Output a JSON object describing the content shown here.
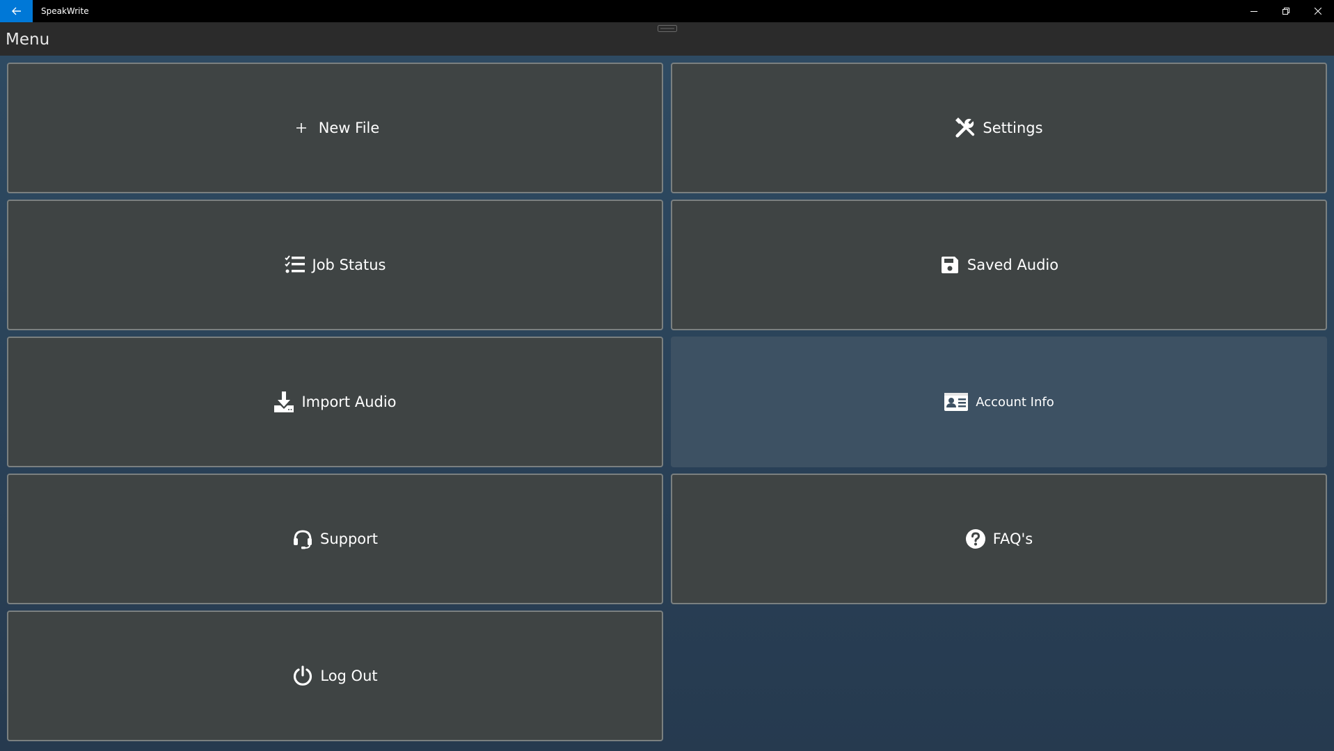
{
  "window": {
    "app_title": "SpeakWrite",
    "accent_color": "#0078d7"
  },
  "header": {
    "title": "Menu"
  },
  "tiles": [
    {
      "label": "New File",
      "icon": "plus-icon"
    },
    {
      "label": "Settings",
      "icon": "tools-icon"
    },
    {
      "label": "Job Status",
      "icon": "checklist-icon"
    },
    {
      "label": "Saved Audio",
      "icon": "save-icon"
    },
    {
      "label": "Import Audio",
      "icon": "download-icon"
    },
    {
      "label": "Account Info",
      "icon": "id-card-icon",
      "highlighted": true
    },
    {
      "label": "Support",
      "icon": "headset-icon"
    },
    {
      "label": "FAQ's",
      "icon": "question-circle-icon"
    },
    {
      "label": "Log Out",
      "icon": "power-icon"
    }
  ]
}
